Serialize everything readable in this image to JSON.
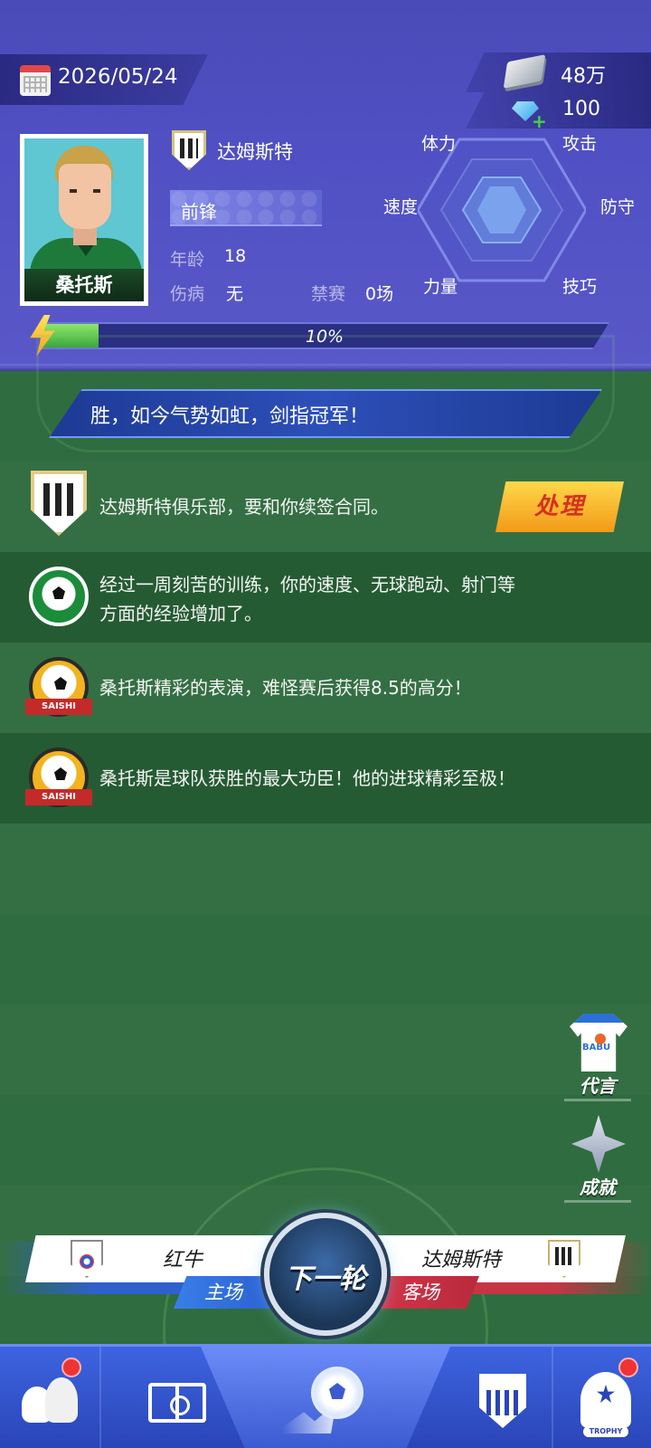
{
  "header": {
    "date": "2026/05/24",
    "money": "48万",
    "gems": "100"
  },
  "player": {
    "name": "桑托斯",
    "club": "达姆斯特",
    "position": "前锋",
    "age_label": "年龄",
    "age": "18",
    "injury_label": "伤病",
    "injury": "无",
    "ban_label": "禁赛",
    "ban": "0场"
  },
  "stats": {
    "stamina": "体力",
    "attack": "攻击",
    "speed": "速度",
    "defense": "防守",
    "strength": "力量",
    "skill": "技巧"
  },
  "energy": {
    "percent_text": "10%",
    "percent": 10
  },
  "news_ticker": "胜，如今气势如虹，剑指冠军！",
  "messages": [
    {
      "text": "达姆斯特俱乐部，要和你续签合同。",
      "icon": "club-shield-icon"
    },
    {
      "text_line1": "经过一周刻苦的训练，你的速度、无球跑动、射门等",
      "text_line2": "方面的经验增加了。",
      "icon": "training-ball-icon"
    },
    {
      "text": "桑托斯精彩的表演，难怪赛后获得8.5的高分！",
      "icon": "saishi-icon"
    },
    {
      "text": "桑托斯是球队获胜的最大功臣！他的进球精彩至极！",
      "icon": "saishi-icon"
    }
  ],
  "saishi_label": "SAISHI",
  "handle_button": "处理",
  "side": {
    "endorse": "代言",
    "achievements": "成就"
  },
  "match": {
    "home_team": "红牛",
    "home_label": "主场",
    "away_team": "达姆斯特",
    "away_label": "客场",
    "next_round": "下一轮"
  },
  "nav": {
    "trophy_label": "TROPHY"
  },
  "colors": {
    "header_bg": "#5050c4",
    "field_green": "#2f6c3f",
    "accent_gold": "#f2b320",
    "home_blue": "#2f5fd0",
    "away_red": "#c93444"
  }
}
